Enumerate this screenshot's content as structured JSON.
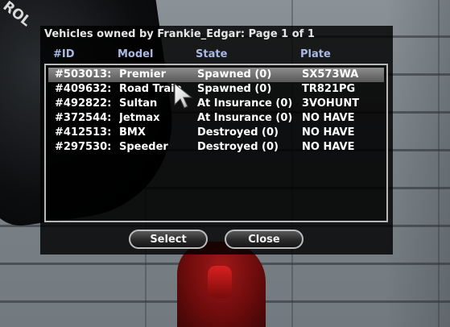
{
  "scene": {
    "vehicle_plate_text": "ROL"
  },
  "dialog": {
    "title": "Vehicles owned by Frankie_Edgar: Page 1 of 1",
    "columns": [
      "#ID",
      "Model",
      "State",
      "Plate"
    ],
    "selected_row": 0,
    "rows": [
      {
        "id": "#503013:",
        "model": "Premier",
        "state": "Spawned (0)",
        "plate": "SX573WA"
      },
      {
        "id": "#409632:",
        "model": "Road Train",
        "state": "Spawned (0)",
        "plate": "TR821PG"
      },
      {
        "id": "#492822:",
        "model": "Sultan",
        "state": "At Insurance (0)",
        "plate": "3VOHUNT"
      },
      {
        "id": "#372544:",
        "model": "Jetmax",
        "state": "At Insurance (0)",
        "plate": "NO HAVE"
      },
      {
        "id": "#412513:",
        "model": "BMX",
        "state": "Destroyed (0)",
        "plate": "NO HAVE"
      },
      {
        "id": "#297530:",
        "model": "Speeder",
        "state": "Destroyed (0)",
        "plate": "NO HAVE"
      }
    ],
    "buttons": {
      "select_label": "Select",
      "close_label": "Close"
    }
  },
  "colors": {
    "header_text": "#a9b9e2",
    "row_text": "#ffffff",
    "selection": "#7a7a7a"
  },
  "icons": {
    "cursor": "mouse-pointer-icon"
  }
}
